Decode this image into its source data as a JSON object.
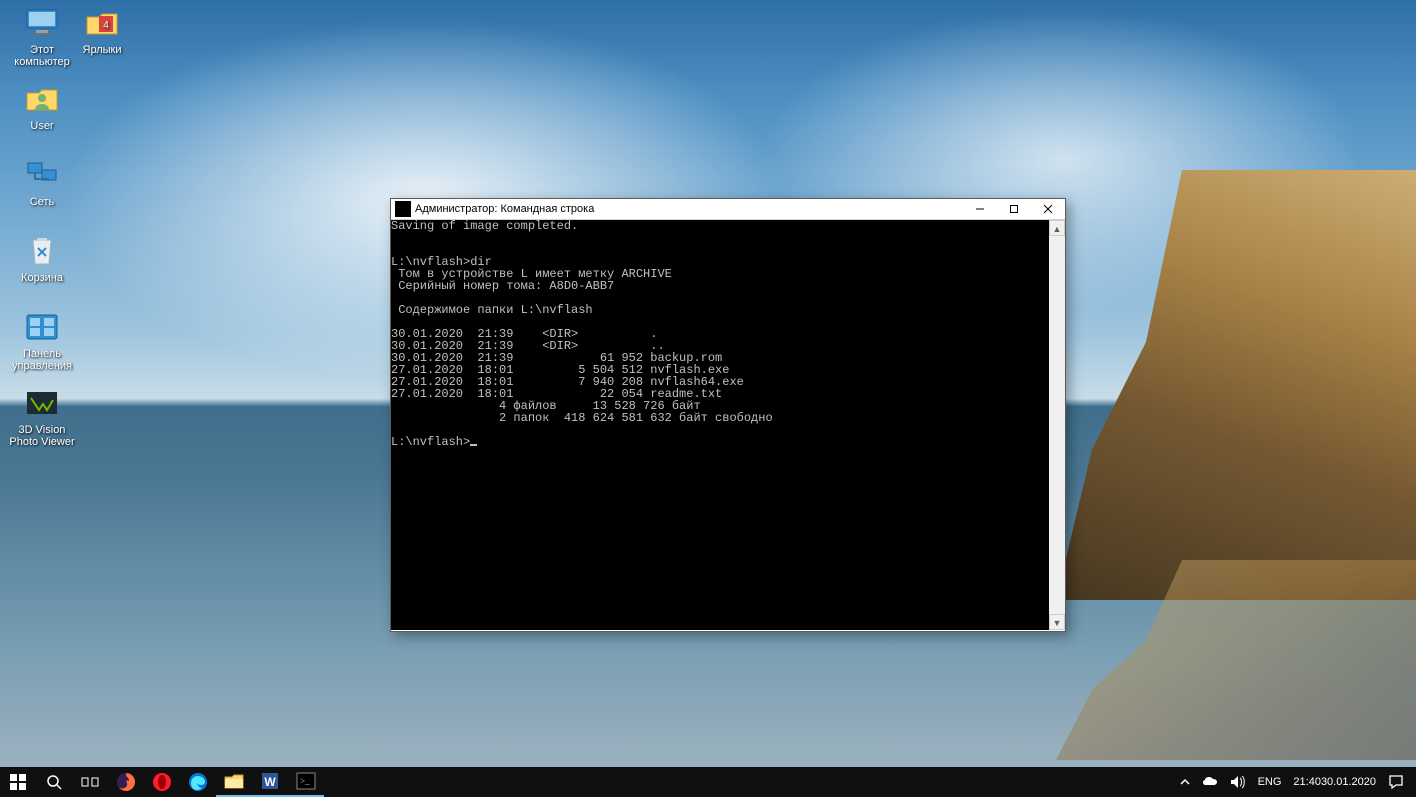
{
  "desktop_icons_col1": [
    {
      "name": "this-pc",
      "label": "Этот\nкомпьютер"
    },
    {
      "name": "user-folder",
      "label": "User"
    },
    {
      "name": "network",
      "label": "Сеть"
    },
    {
      "name": "recycle-bin",
      "label": "Корзина"
    },
    {
      "name": "control-panel",
      "label": "Панель\nуправления"
    },
    {
      "name": "3dvision",
      "label": "3D Vision\nPhoto Viewer"
    }
  ],
  "desktop_icons_col2": [
    {
      "name": "shortcuts",
      "label": "Ярлыки"
    }
  ],
  "window": {
    "title": "Администратор: Командная строка",
    "terminal_text": "Saving of image completed.\n\n\nL:\\nvflash>dir\n Том в устройстве L имеет метку ARCHIVE\n Серийный номер тома: A8D0-ABB7\n\n Содержимое папки L:\\nvflash\n\n30.01.2020  21:39    <DIR>          .\n30.01.2020  21:39    <DIR>          ..\n30.01.2020  21:39            61 952 backup.rom\n27.01.2020  18:01         5 504 512 nvflash.exe\n27.01.2020  18:01         7 940 208 nvflash64.exe\n27.01.2020  18:01            22 054 readme.txt\n               4 файлов     13 528 726 байт\n               2 папок  418 624 581 632 байт свободно\n\nL:\\nvflash>"
  },
  "tray": {
    "lang": "ENG",
    "time": "21:40",
    "date": "30.01.2020"
  }
}
